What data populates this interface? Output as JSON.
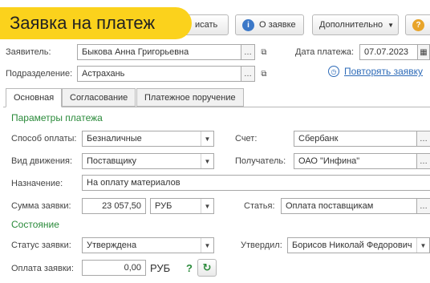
{
  "window": {
    "title": "Заявка на платеж"
  },
  "toolbar": {
    "write_label": "исать",
    "about_label": "О заявке",
    "more_label": "Дополнительно",
    "help_icon": "question-icon"
  },
  "header": {
    "applicant_label": "Заявитель:",
    "applicant_value": "Быкова Анна Григорьевна",
    "department_label": "Подразделение:",
    "department_value": "Астрахань",
    "payment_date_label": "Дата платежа:",
    "payment_date_value": "07.07.2023",
    "repeat_link": "Повторять заявку"
  },
  "tabs": [
    {
      "label": "Основная"
    },
    {
      "label": "Согласование"
    },
    {
      "label": "Платежное поручение"
    }
  ],
  "params": {
    "section_title": "Параметры платежа",
    "payment_method_label": "Способ оплаты:",
    "payment_method_value": "Безналичные",
    "account_label": "Счет:",
    "account_value": "Сбербанк",
    "movement_type_label": "Вид движения:",
    "movement_type_value": "Поставщику",
    "recipient_label": "Получатель:",
    "recipient_value": "ОАО \"Инфина\"",
    "purpose_label": "Назначение:",
    "purpose_value": "На оплату материалов",
    "amount_label": "Сумма заявки:",
    "amount_value": "23 057,50",
    "currency_value": "РУБ",
    "article_label": "Статья:",
    "article_value": "Оплата поставщикам"
  },
  "status": {
    "section_title": "Состояние",
    "status_label": "Статус заявки:",
    "status_value": "Утверждена",
    "approved_by_label": "Утвердил:",
    "approved_by_value": "Борисов Николай Федорович",
    "payment_label": "Оплата заявки:",
    "payment_value": "0,00",
    "payment_currency": "РУБ",
    "hint": "?"
  },
  "colors": {
    "banner": "#fbd21c",
    "section": "#2a8a3a",
    "link": "#2e6bb8"
  }
}
